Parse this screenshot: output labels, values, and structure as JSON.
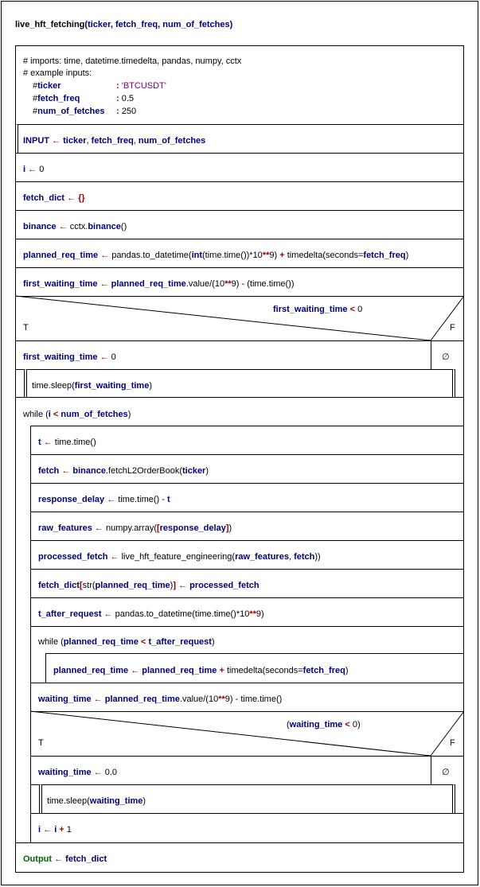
{
  "title": {
    "name": "live_hft_fetching",
    "open": "(",
    "p1": "ticker",
    "c1": ", ",
    "p2": "fetch_freq",
    "c2": ", ",
    "p3": "num_of_fetches",
    "close": ")"
  },
  "comments": {
    "l1": "# imports: time, datetime.timedelta, pandas, numpy, cctx",
    "l2": "# example inputs:",
    "l3_hash": "#",
    "l3_name": "ticker",
    "l3_colon": ": ",
    "l3_val": "'BTCUSDT'",
    "l4_hash": "#",
    "l4_name": "fetch_freq",
    "l4_colon": ": ",
    "l4_val": "0.5",
    "l5_hash": "#",
    "l5_name": "num_of_fetches",
    "l5_colon": ": ",
    "l5_val": "250"
  },
  "input_stmt": {
    "kw": "INPUT",
    "arrow": " ← ",
    "p1": "ticker",
    "c1": ", ",
    "p2": "fetch_freq",
    "c2": ", ",
    "p3": "num_of_fetches"
  },
  "s_i": {
    "v": "i",
    "arrow": " ← ",
    "val": "0"
  },
  "s_dict": {
    "v": "fetch_dict",
    "arrow": " ← ",
    "val": "{}"
  },
  "s_binance": {
    "v": "binance",
    "arrow": " ← ",
    "a": "cctx.",
    "b": "binance",
    "c": "()"
  },
  "s_planned": {
    "v": "planned_req_time",
    "arrow": " ← ",
    "a": "pandas.to_datetime(",
    "b": "int",
    "c": "(time.time())*10",
    "d": "**",
    "e": "9) ",
    "f": "+",
    "g": " timedelta(seconds=",
    "h": "fetch_freq",
    "i": ")"
  },
  "s_first": {
    "v": "first_waiting_time",
    "arrow": " ← ",
    "b": "planned_req_time",
    "c": ".value/(10",
    "d": "**",
    "e": "9) - (time.time())"
  },
  "if1": {
    "cond_v": "first_waiting_time",
    "cond_op": " < ",
    "cond_val": "0",
    "t": "T",
    "f": "F",
    "empty": "∅"
  },
  "if1_then": {
    "v": "first_waiting_time",
    "arrow": " ← ",
    "val": "0"
  },
  "if1_sleep": {
    "a": "time.sleep(",
    "b": "first_waiting_time",
    "c": ")"
  },
  "while1": {
    "kw": "while (",
    "v": "i",
    "op": " < ",
    "b": "num_of_fetches",
    "c": ")"
  },
  "s_t": {
    "v": "t",
    "arrow": " ← ",
    "val": "time.time()"
  },
  "s_fetch": {
    "v": "fetch",
    "arrow": " ← ",
    "b": "binance",
    "c": ".fetchL2OrderBook(",
    "d": "ticker",
    "e": ")"
  },
  "s_resp": {
    "v": "response_delay",
    "arrow": " ← ",
    "b": "time.time() - ",
    "c": "t"
  },
  "s_raw": {
    "v": "raw_features",
    "arrow": " ← ",
    "b": "numpy.array(",
    "c": "[",
    "d": "response_delay",
    "e": "]",
    "f": ")"
  },
  "s_proc": {
    "v": "processed_fetch",
    "arrow": " ← ",
    "b": "live_hft_feature_engineering(",
    "c": "raw_features",
    "d": ", ",
    "e": "fetch",
    "f": "))"
  },
  "s_dictset": {
    "v": "fetch_dict",
    "b": "[",
    "c": "str(",
    "d": "planned_req_time",
    "e": ")",
    "f": "]",
    "arrow": " ← ",
    "g": "processed_fetch"
  },
  "s_after": {
    "v": "t_after_request",
    "arrow": " ← ",
    "b": "pandas.to_datetime(time.time()*10",
    "c": "**",
    "d": "9)"
  },
  "while2": {
    "kw": "while (",
    "v": "planned_req_time",
    "op": " < ",
    "b": "t_after_request",
    "c": ")"
  },
  "s_inc": {
    "v": "planned_req_time",
    "arrow": " ← ",
    "b": "planned_req_time",
    "plus": " + ",
    "c": "timedelta(seconds=",
    "d": "fetch_freq",
    "e": ")"
  },
  "s_wait": {
    "v": "waiting_time",
    "arrow": " ← ",
    "b": "planned_req_time",
    "c": ".value/(10",
    "d": "**",
    "e": "9) - time.time()"
  },
  "if2": {
    "open": "(",
    "cond_v": "waiting_time",
    "cond_op": " < ",
    "cond_val": "0",
    "close": ")",
    "t": "T",
    "f": "F",
    "empty": "∅"
  },
  "if2_then": {
    "v": "waiting_time",
    "arrow": " ← ",
    "val": "0.0"
  },
  "if2_sleep": {
    "a": "time.sleep(",
    "b": "waiting_time",
    "c": ")"
  },
  "s_iinc": {
    "v": "i",
    "arrow": " ← ",
    "b": "i",
    "plus": " + ",
    "c": "1"
  },
  "output_stmt": {
    "kw": "Output",
    "arrow": " ← ",
    "v": "fetch_dict"
  }
}
